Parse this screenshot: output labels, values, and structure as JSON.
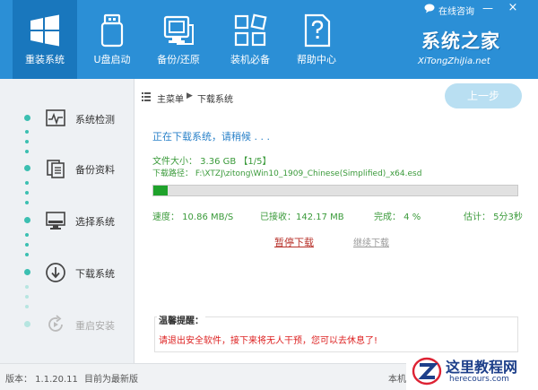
{
  "colors": {
    "header": "#2b8fd6",
    "header_active": "#1977bd",
    "accent_teal": "#3bbfb1",
    "progress": "#1fa22b",
    "status_blue": "#2b82c9",
    "stat_green": "#3a9a3a",
    "warning_red": "#d22"
  },
  "header": {
    "nav": [
      {
        "label": "重装系统",
        "icon": "windows-logo-icon",
        "active": true
      },
      {
        "label": "U盘启动",
        "icon": "usb-drive-icon"
      },
      {
        "label": "备份/还原",
        "icon": "backup-restore-icon"
      },
      {
        "label": "装机必备",
        "icon": "apps-grid-icon"
      },
      {
        "label": "帮助中心",
        "icon": "help-document-icon"
      }
    ],
    "consult_label": "在线咨询",
    "minimize_symbol": "—",
    "close_symbol": "×",
    "brand_cn": "系统之家",
    "brand_en": "XiTongZhiJia.net"
  },
  "sidebar": {
    "steps": [
      {
        "label": "系统检测",
        "icon": "monitor-pulse-icon"
      },
      {
        "label": "备份资料",
        "icon": "documents-icon"
      },
      {
        "label": "选择系统",
        "icon": "desktop-icon"
      },
      {
        "label": "下载系统",
        "icon": "download-icon"
      },
      {
        "label": "重启安装",
        "icon": "restart-icon",
        "disabled": true
      }
    ]
  },
  "content": {
    "breadcrumb": {
      "root": "主菜单",
      "arrow": "▶",
      "current": "下载系统"
    },
    "back_button": "上一步",
    "status": "正在下载系统，请稍候 . . .",
    "file_size": "文件大小： 3.36 GB 【1/5】",
    "file_path": "下载路径： F:\\XTZJ\\zitong\\Win10_1909_Chinese(Simplified)_x64.esd",
    "progress_percent": 4,
    "stats": {
      "speed": "速度： 10.86 MB/S",
      "received": "已接收：142.17 MB",
      "done": "完成： 4 %",
      "eta": "估计： 5分3秒"
    },
    "pause_link": "暂停下载",
    "resume_link": "继续下载",
    "tip_title": "温馨提醒：",
    "tip_text": "请退出安全软件，接下来将无人干预，您可以去休息了!"
  },
  "footer": {
    "version": "版本： 1.1.20.11",
    "latest": "目前为最新版",
    "machine": "本机"
  },
  "watermark": {
    "cn": "这里教程网",
    "en": "herecours.com"
  }
}
